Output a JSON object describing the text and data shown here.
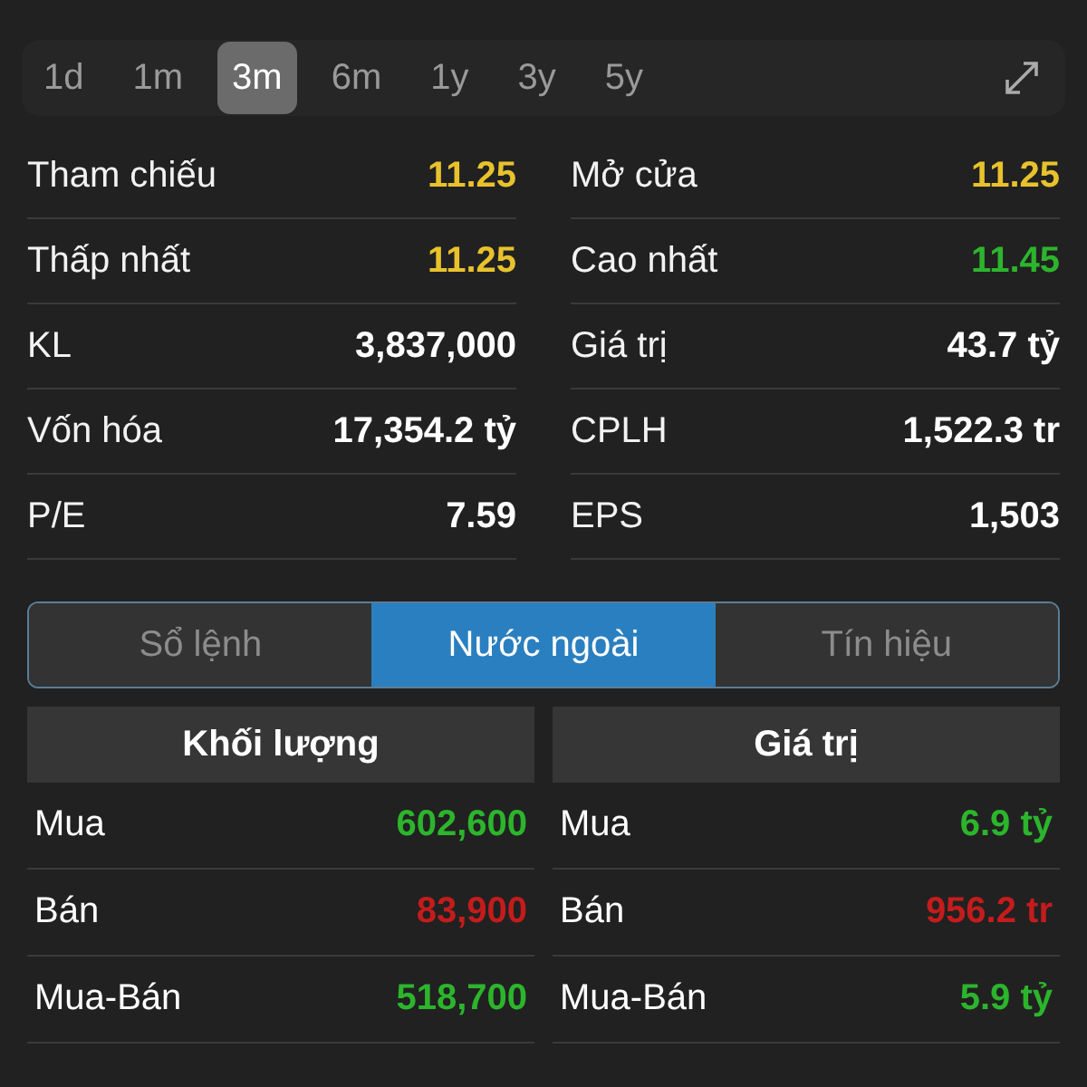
{
  "ranges": [
    {
      "label": "1d",
      "selected": false
    },
    {
      "label": "1m",
      "selected": false
    },
    {
      "label": "3m",
      "selected": true
    },
    {
      "label": "6m",
      "selected": false
    },
    {
      "label": "1y",
      "selected": false
    },
    {
      "label": "3y",
      "selected": false
    },
    {
      "label": "5y",
      "selected": false
    }
  ],
  "stats": [
    {
      "label": "Tham chiếu",
      "value": "11.25",
      "color": "#e8c22c"
    },
    {
      "label": "Mở cửa",
      "value": "11.25",
      "color": "#e8c22c"
    },
    {
      "label": "Thấp nhất",
      "value": "11.25",
      "color": "#e8c22c"
    },
    {
      "label": "Cao nhất",
      "value": "11.45",
      "color": "#2cb52c"
    },
    {
      "label": "KL",
      "value": "3,837,000",
      "color": "#ffffff"
    },
    {
      "label": "Giá trị",
      "value": "43.7 tỷ",
      "color": "#ffffff"
    },
    {
      "label": "Vốn hóa",
      "value": "17,354.2 tỷ",
      "color": "#ffffff"
    },
    {
      "label": "CPLH",
      "value": "1,522.3 tr",
      "color": "#ffffff"
    },
    {
      "label": "P/E",
      "value": "7.59",
      "color": "#ffffff"
    },
    {
      "label": "EPS",
      "value": "1,503",
      "color": "#ffffff"
    }
  ],
  "tabs": [
    {
      "label": "Sổ lệnh",
      "selected": false
    },
    {
      "label": "Nước ngoài",
      "selected": true
    },
    {
      "label": "Tín hiệu",
      "selected": false
    }
  ],
  "tables": [
    {
      "header": "Khối lượng",
      "rows": [
        {
          "label": "Mua",
          "value": "602,600",
          "color": "#2cb52c"
        },
        {
          "label": "Bán",
          "value": "83,900",
          "color": "#c41c1c"
        },
        {
          "label": "Mua-Bán",
          "value": "518,700",
          "color": "#2cb52c"
        }
      ]
    },
    {
      "header": "Giá trị",
      "rows": [
        {
          "label": "Mua",
          "value": "6.9 tỷ",
          "color": "#2cb52c"
        },
        {
          "label": "Bán",
          "value": "956.2 tr",
          "color": "#c41c1c"
        },
        {
          "label": "Mua-Bán",
          "value": "5.9 tỷ",
          "color": "#2cb52c"
        }
      ]
    }
  ]
}
